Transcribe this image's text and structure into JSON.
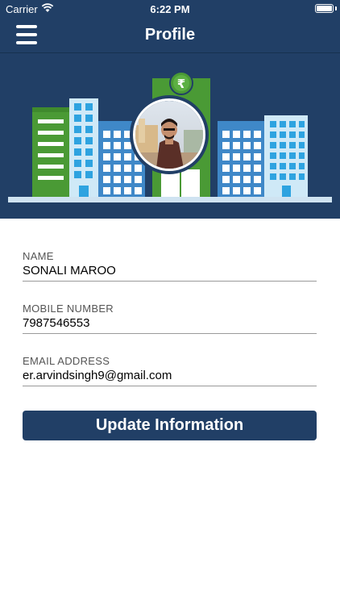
{
  "status_bar": {
    "carrier": "Carrier",
    "time": "6:22 PM"
  },
  "navbar": {
    "title": "Profile",
    "menu_icon": "hamburger-menu-icon"
  },
  "header": {
    "background_color": "#213f66",
    "currency_icon": "rupee-icon",
    "currency_symbol": "₹"
  },
  "form": {
    "name": {
      "label": "NAME",
      "value": "SONALI MAROO"
    },
    "mobile": {
      "label": "MOBILE NUMBER",
      "value": "7987546553"
    },
    "email": {
      "label": "EMAIL ADDRESS",
      "value": "er.arvindsingh9@gmail.com"
    }
  },
  "update_button": {
    "label": "Update Information",
    "color": "#213f66"
  }
}
